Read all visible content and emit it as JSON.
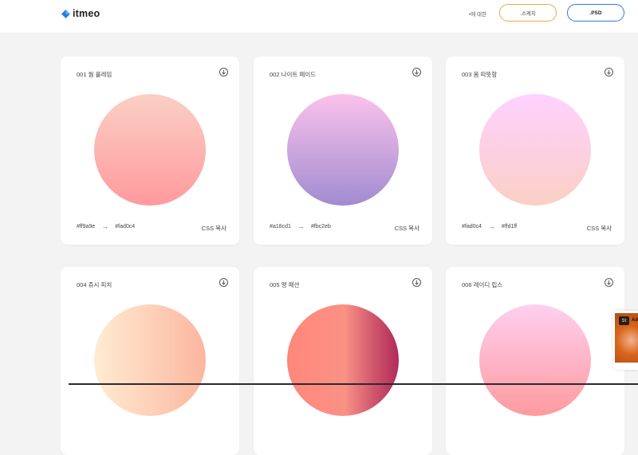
{
  "header": {
    "logo_text": "itmeo",
    "nav_about": "•에 대한",
    "btn_sketch": ".스케치",
    "btn_psd": ".PSD"
  },
  "cards": [
    {
      "title": "001 웜 플레임",
      "from": "#ff9a9e",
      "to": "#fad0c4",
      "copy": "CSS 복사"
    },
    {
      "title": "002 나이트 페이드",
      "from": "#a18cd1",
      "to": "#fbc2eb",
      "copy": "CSS 복사"
    },
    {
      "title": "003 봄 따뜻함",
      "from": "#fad0c4",
      "to": "#ffd1ff",
      "copy": "CSS 복사"
    },
    {
      "title": "004 쥬시 피치"
    },
    {
      "title": "005 맹 패션"
    },
    {
      "title": "006 레이디 립스"
    }
  ],
  "ad": {
    "badge": "St",
    "text": "Ad"
  },
  "icons": {
    "download": "download-circle-icon",
    "arrow": "arrow-right-icon"
  }
}
